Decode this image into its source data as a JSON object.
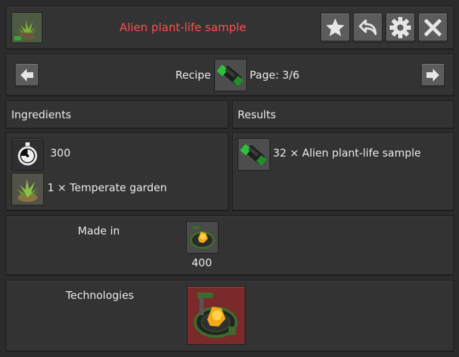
{
  "header": {
    "title": "Alien plant-life sample",
    "icon": "alien-plant-icon",
    "title_color": "#ff4d4d",
    "buttons": [
      "star-icon",
      "undo-arrow-icon",
      "gear-icon",
      "close-icon"
    ]
  },
  "nav": {
    "recipe_label": "Recipe",
    "page_label": "Page: 3/6",
    "recipe_icon": "alien-plant-sample-icon"
  },
  "ingredients": {
    "heading": "Ingredients",
    "time_value": "300",
    "items": [
      {
        "icon": "temperate-garden-icon",
        "text": "1 × Temperate garden"
      }
    ]
  },
  "results": {
    "heading": "Results",
    "items": [
      {
        "icon": "alien-plant-sample-icon",
        "text": "32 × Alien plant-life sample"
      }
    ]
  },
  "made_in": {
    "label": "Made in",
    "machine_icon": "bioprocessor-icon",
    "value": "400"
  },
  "technologies": {
    "label": "Technologies",
    "icon": "bioprocessing-tech-icon",
    "highlight_color": "#7a2a2a"
  }
}
